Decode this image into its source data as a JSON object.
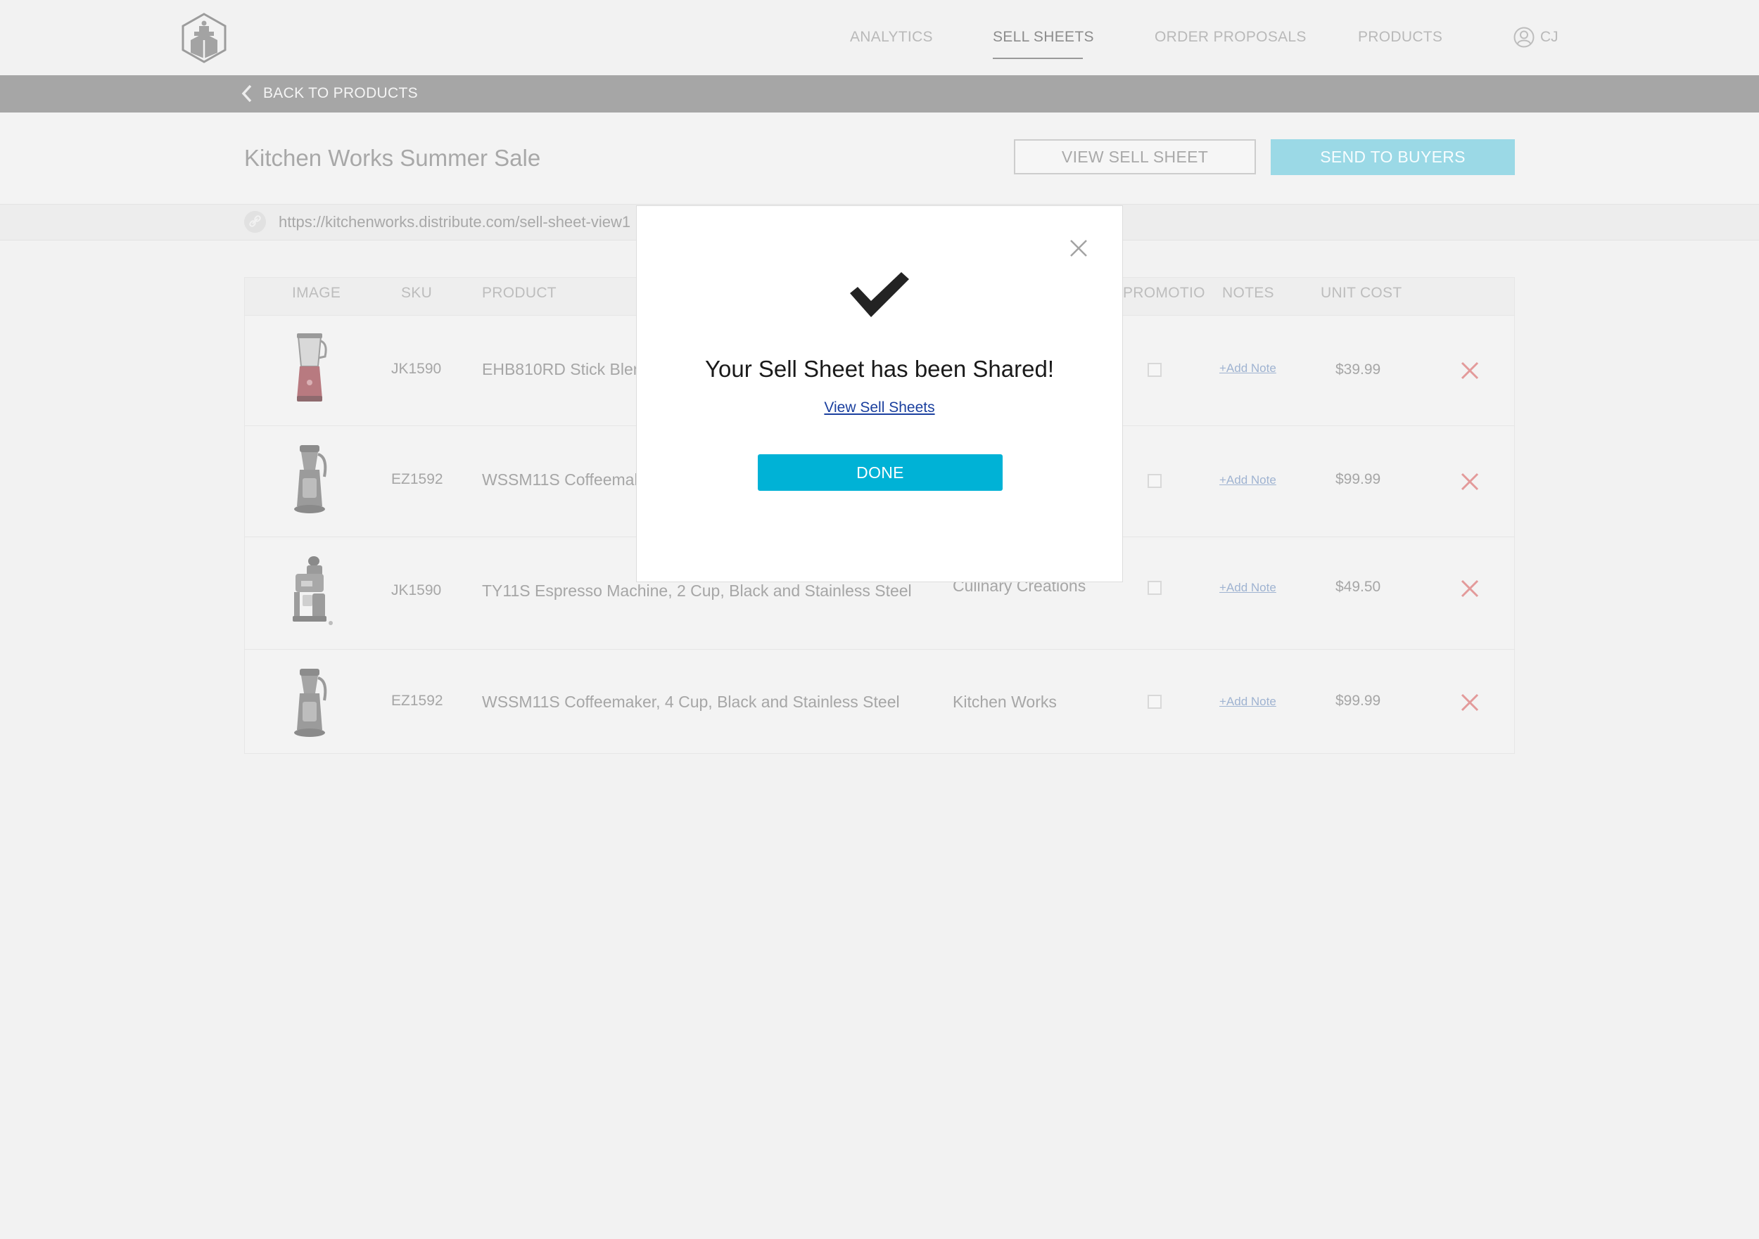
{
  "nav": {
    "links": [
      "ANALYTICS",
      "SELL SHEETS",
      "ORDER PROPOSALS",
      "PRODUCTS"
    ],
    "active": "SELL SHEETS",
    "user_initials": "CJ"
  },
  "backbar": {
    "label": "BACK TO PRODUCTS"
  },
  "header": {
    "title": "Kitchen Works Summer Sale",
    "view_button": "VIEW SELL SHEET",
    "send_button": "SEND TO BUYERS"
  },
  "url": {
    "text": "https://kitchenworks.distribute.com/sell-sheet-view1"
  },
  "table": {
    "columns": [
      "IMAGE",
      "SKU",
      "PRODUCT",
      "PROMOTIO",
      "NOTES",
      "UNIT COST"
    ],
    "rows": [
      {
        "sku": "JK1590",
        "product": "EHB810RD Stick Blender",
        "vendor": "",
        "note": "+Add Note",
        "cost": "$39.99",
        "image": "blender-image"
      },
      {
        "sku": "EZ1592",
        "product": "WSSM11S Coffeemaker",
        "vendor": "",
        "note": "+Add Note",
        "cost": "$99.99",
        "image": "coffeemaker-image"
      },
      {
        "sku": "JK1590",
        "product": "TY11S Espresso Machine, 2 Cup, Black and Stainless Steel",
        "vendor": "Culinary Creations",
        "note": "+Add Note",
        "cost": "$49.50",
        "image": "espresso-machine-image"
      },
      {
        "sku": "EZ1592",
        "product": "WSSM11S Coffeemaker, 4 Cup, Black and Stainless Steel",
        "vendor": "Kitchen Works",
        "note": "+Add Note",
        "cost": "$99.99",
        "image": "coffeemaker-image"
      }
    ]
  },
  "modal": {
    "title": "Your Sell Sheet has been Shared!",
    "link": "View Sell Sheets",
    "done_button": "DONE"
  },
  "colors": {
    "accent": "#00b2d6",
    "accent_muted": "#9bd9e6",
    "remove": "#e39a9a",
    "link": "#1a3f9e"
  }
}
